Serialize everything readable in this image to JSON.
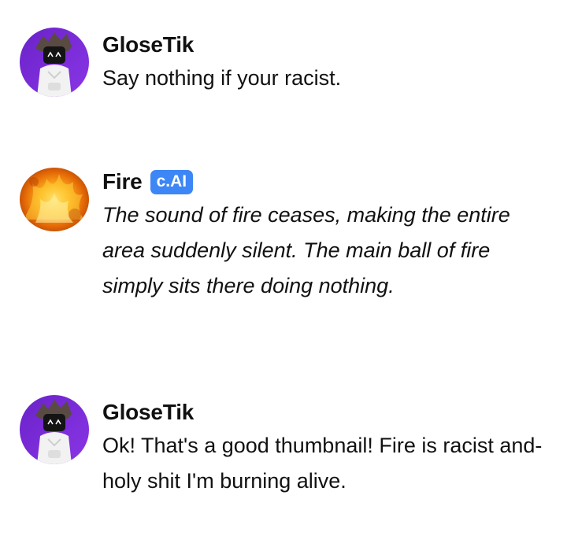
{
  "messages": [
    {
      "author": "GloseTik",
      "avatar": "user-avatar-icon",
      "text": "Say nothing if your racist.",
      "italic": false
    },
    {
      "author": "Fire",
      "badge": "c.AI",
      "avatar": "fire-avatar-icon",
      "text": "The sound of fire ceases, making the entire area suddenly silent. The main ball of fire simply sits there doing nothing.",
      "italic": true
    },
    {
      "author": "GloseTik",
      "avatar": "user-avatar-icon",
      "text": "Ok! That's a good thumbnail! Fire is racist and- holy shit I'm burning alive.",
      "italic": false
    }
  ],
  "colors": {
    "badge": "#3d86f5",
    "user_avatar_bg": "#7b2ad6",
    "text": "#111111"
  }
}
